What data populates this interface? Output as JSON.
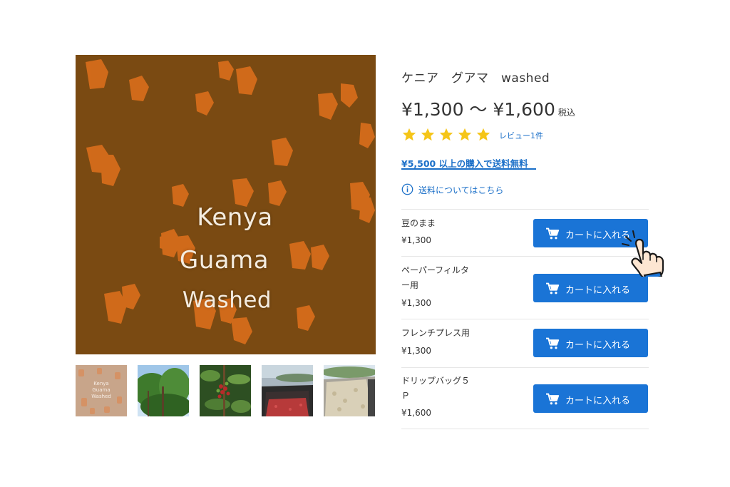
{
  "main_image": {
    "lines": [
      "Kenya",
      "Guama",
      "Washed"
    ],
    "bg_color": "#7a4a12",
    "spot_color": "#e0701c"
  },
  "thumbnails": [
    {
      "label": "Kenya Guama Washed",
      "lines": [
        "Kenya",
        "Guama",
        "Washed"
      ]
    },
    {
      "label": "coffee-tree"
    },
    {
      "label": "coffee-cherries"
    },
    {
      "label": "drying-beds-red"
    },
    {
      "label": "drying-beds-beans"
    }
  ],
  "product": {
    "title": "ケニア　グアマ　washed",
    "price": "¥1,300 〜 ¥1,600",
    "tax_label": "税込",
    "rating": 5,
    "review_link": "レビュー1件",
    "free_shipping": "¥5,500 以上の購入で送料無料",
    "shipping_info": "送料についてはこちら"
  },
  "variants": [
    {
      "name": "豆のまま",
      "price": "¥1,300",
      "button": "カートに入れる"
    },
    {
      "name": "ペーパーフィルター用",
      "name_lines": [
        "ペーパーフィルタ",
        "ー用"
      ],
      "price": "¥1,300",
      "button": "カートに入れる"
    },
    {
      "name": "フレンチプレス用",
      "price": "¥1,300",
      "button": "カートに入れる"
    },
    {
      "name": "ドリップバッグ５Ｐ",
      "name_lines": [
        "ドリップバッグ５",
        "Ｐ"
      ],
      "price": "¥1,600",
      "button": "カートに入れる"
    }
  ],
  "colors": {
    "accent": "#1a74d6",
    "link": "#1a6fc8",
    "star": "#f5c518",
    "text": "#333333"
  }
}
